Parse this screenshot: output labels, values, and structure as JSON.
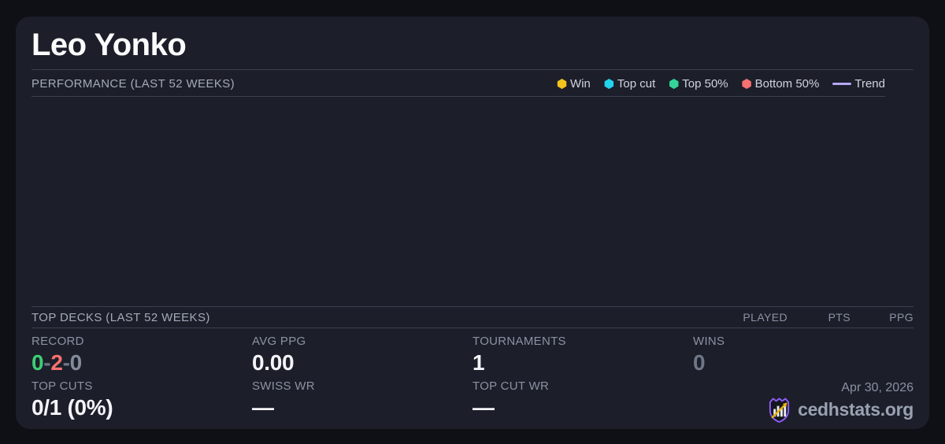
{
  "page": {
    "background": "#0e1015",
    "card_background": "#1c1f29"
  },
  "header": {
    "title": "Leo Yonko"
  },
  "performance": {
    "section_title": "PERFORMANCE (LAST 52 WEEKS)",
    "legend": [
      {
        "label": "Win",
        "color": "#f2c21d",
        "marker": "hex"
      },
      {
        "label": "Top cut",
        "color": "#22d3ee",
        "marker": "hex"
      },
      {
        "label": "Top 50%",
        "color": "#34d399",
        "marker": "hex"
      },
      {
        "label": "Bottom 50%",
        "color": "#f87171",
        "marker": "hex"
      },
      {
        "label": "Trend",
        "color": "#b6a7f8",
        "marker": "line"
      }
    ],
    "chart_data": {
      "type": "scatter",
      "title": "PERFORMANCE (LAST 52 WEEKS)",
      "points": [],
      "series": [],
      "legend_position": "top-right",
      "grid": false,
      "note_empty": "chart area rendered with no data points"
    }
  },
  "top_decks": {
    "section_title": "TOP DECKS (LAST 52 WEEKS)",
    "columns": [
      "PLAYED",
      "PTS",
      "PPG"
    ],
    "rows": []
  },
  "stats": {
    "record": {
      "label": "RECORD",
      "wins": "0",
      "losses": "2",
      "draws": "0",
      "separator": "-"
    },
    "avg_ppg": {
      "label": "AVG PPG",
      "value": "0.00"
    },
    "tournaments": {
      "label": "TOURNAMENTS",
      "value": "1"
    },
    "wins": {
      "label": "WINS",
      "value": "0"
    },
    "top_cuts": {
      "label": "TOP CUTS",
      "value": "0/1 (0%)"
    },
    "swiss_wr": {
      "label": "SWISS WR",
      "value": "—"
    },
    "top_cut_wr": {
      "label": "TOP CUT WR",
      "value": "—"
    }
  },
  "footer": {
    "date": "Apr 30, 2026",
    "brand": "cedhstats.org",
    "logo_colors": {
      "shield": "#8b5cf6",
      "bars": "#e8eaf0",
      "arrow": "#eab308"
    }
  }
}
